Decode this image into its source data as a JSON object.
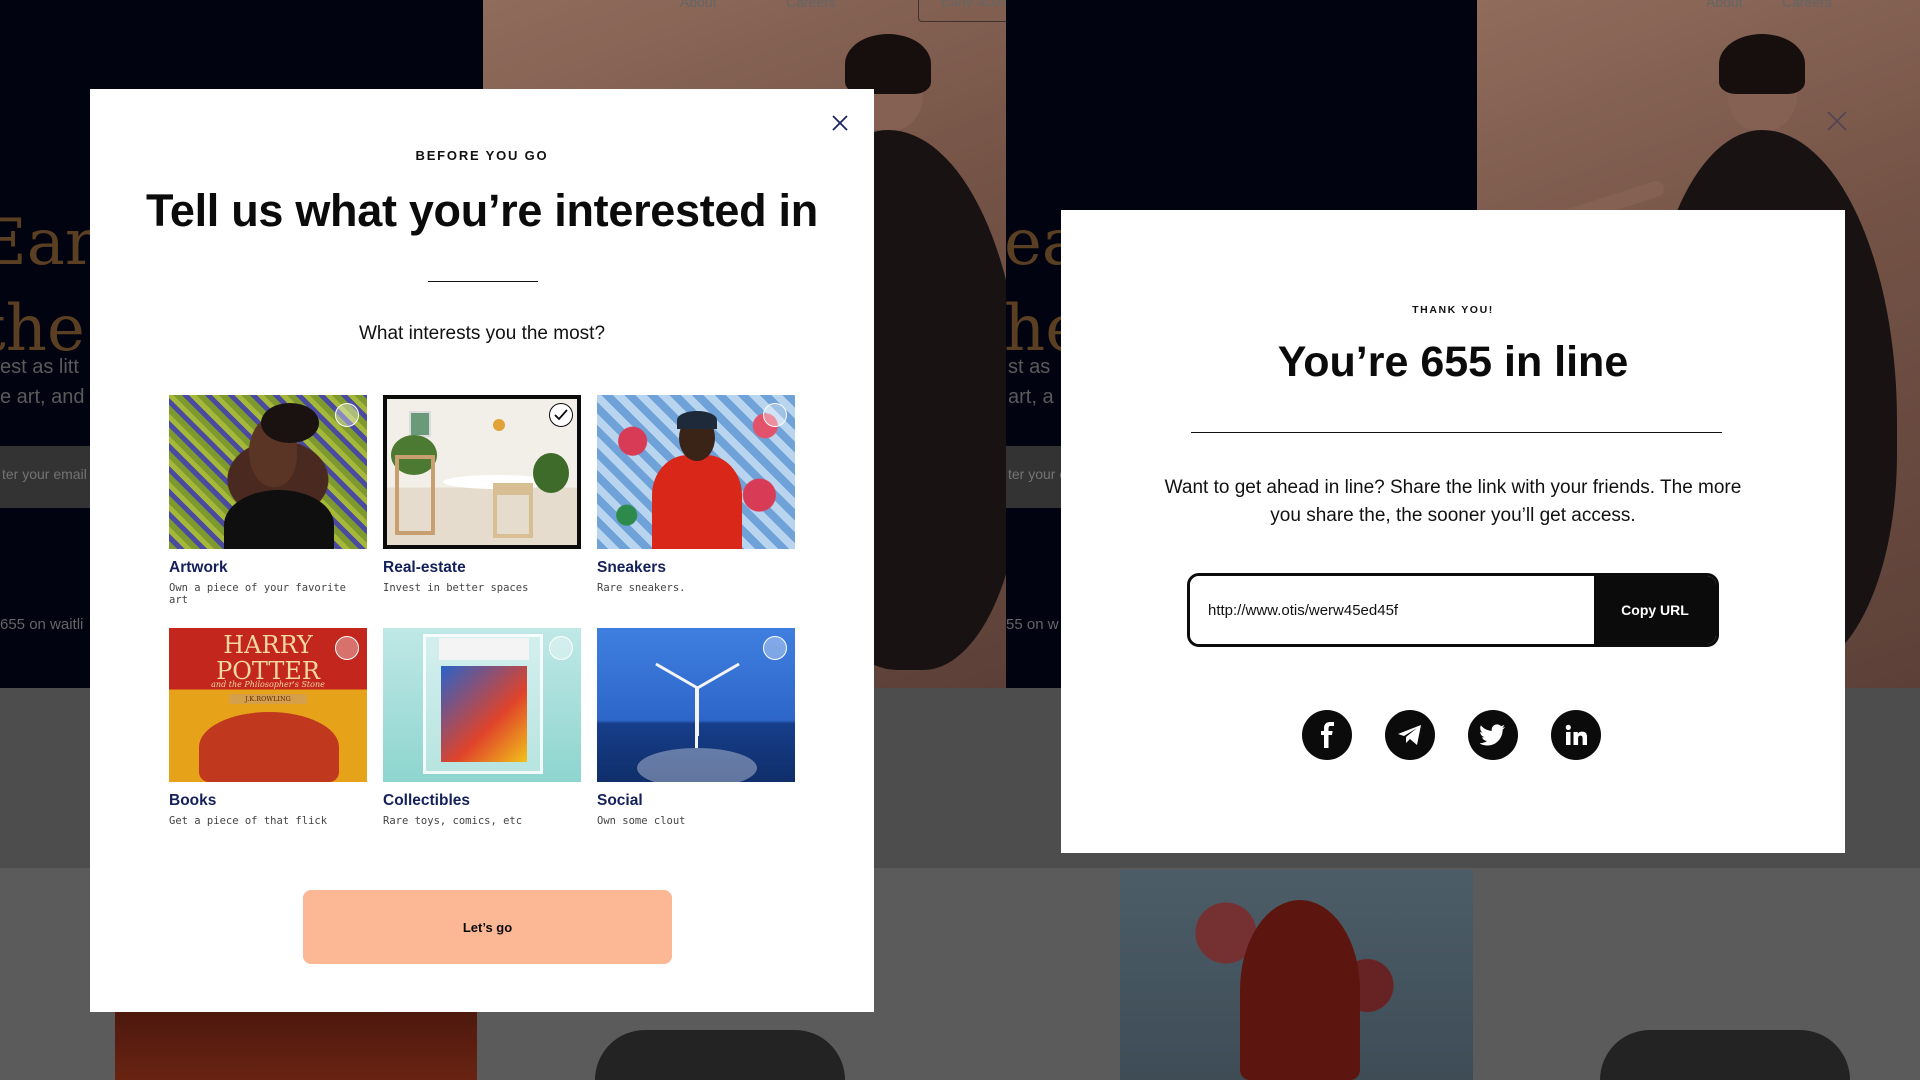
{
  "background": {
    "title_left": "Earn\nthe i",
    "title_right": "ear\nhe",
    "subtitle_left": "est as litt\ne art, and",
    "subtitle_right": "st as\nart, a",
    "email_placeholder_left": "ter your email",
    "email_placeholder_right": "ter your e",
    "waitlist_left": "655 on waitli",
    "waitlist_right": "55 on w",
    "nav_about": "About",
    "nav_careers": "Careers",
    "nav_early": "Early acce"
  },
  "interests_modal": {
    "eyebrow": "BEFORE YOU GO",
    "title": "Tell us what you’re interested in",
    "question": "What interests you the most?",
    "cards": [
      {
        "label": "Artwork",
        "desc": "Own a piece of your favorite art",
        "selected": false
      },
      {
        "label": "Real-estate",
        "desc": "Invest in better spaces",
        "selected": true
      },
      {
        "label": "Sneakers",
        "desc": "Rare sneakers.",
        "selected": false
      },
      {
        "label": "Books",
        "desc": "Get a piece of that flick",
        "selected": false
      },
      {
        "label": "Collectibles",
        "desc": "Rare toys, comics, etc",
        "selected": false
      },
      {
        "label": "Social",
        "desc": "Own some clout",
        "selected": false
      }
    ],
    "book_cover": {
      "line1": "HARRY",
      "line2": "POTTER",
      "subtitle": "and the Philosopher's Stone",
      "author": "J.K.ROWLING"
    },
    "cta_label": "Let’s go"
  },
  "thanks_modal": {
    "eyebrow": "THANK YOU!",
    "title": "You’re 655 in line",
    "body": "Want to get ahead in line? Share the link with your friends. The more you share the, the sooner you’ll get access.",
    "share_url": "http://www.otis/werw45ed45f",
    "copy_label": "Copy URL",
    "socials": [
      "facebook-icon",
      "telegram-icon",
      "twitter-icon",
      "linkedin-icon"
    ]
  },
  "colors": {
    "navy": "#020413",
    "cta": "#fcb895",
    "card_label": "#14205a"
  }
}
